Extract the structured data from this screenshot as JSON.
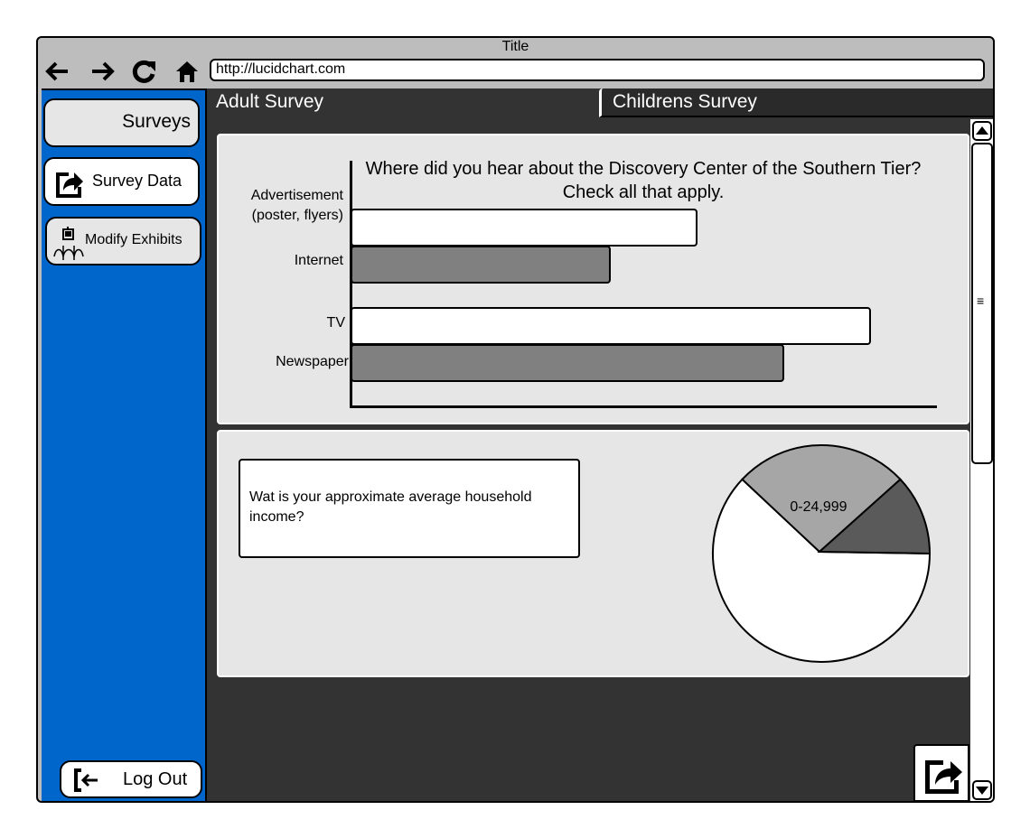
{
  "window": {
    "title": "Title"
  },
  "browser": {
    "url": "http://lucidchart.com",
    "nav_icons": [
      "arrow-left-icon",
      "arrow-right-icon",
      "refresh-icon",
      "home-icon"
    ]
  },
  "sidebar": {
    "surveys_label": "Surveys",
    "survey_data_label": "Survey Data",
    "modify_exhibits_label": "Modify Exhibits",
    "logout_label": "Log Out"
  },
  "tabs": [
    {
      "label": "Adult Survey",
      "selected": true
    },
    {
      "label": "Childrens Survey",
      "selected": false
    }
  ],
  "question2": {
    "text": "Wat is your approximate average household income?"
  },
  "colors": {
    "sidebar": "#0066cc",
    "content_bg": "#333333",
    "panel_bg": "#e6e6e6",
    "bar_dark": "#808080",
    "bar_light": "#ffffff"
  },
  "chart_data": [
    {
      "type": "bar",
      "orientation": "horizontal",
      "title": "Where did you hear about the Discovery Center of the Southern Tier? Check all that apply.",
      "categories": [
        "Advertisement (poster, flyers)",
        "Internet",
        "TV",
        "Newspaper"
      ],
      "values": [
        60,
        45,
        90,
        75
      ],
      "xlim": [
        0,
        100
      ],
      "colors": [
        "#ffffff",
        "#808080",
        "#ffffff",
        "#808080"
      ]
    },
    {
      "type": "pie",
      "labels": [
        "0-24,999",
        "",
        ""
      ],
      "values": [
        62,
        26,
        12
      ],
      "colors": [
        "#ffffff",
        "#a6a6a6",
        "#5a5a5a"
      ]
    }
  ]
}
